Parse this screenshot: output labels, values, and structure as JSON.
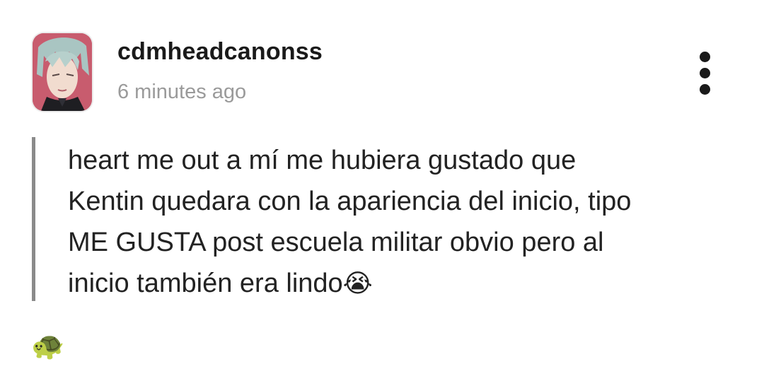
{
  "post": {
    "author": {
      "username": "cdmheadcanonss",
      "avatar_icon": "anime-character-avatar"
    },
    "timestamp": "6 minutes ago",
    "menu_icon": "more-vertical-icon",
    "text_lines": [
      "heart me out a mí me hubiera gustado que",
      "Kentin quedara con la apariencia del inicio, tipo",
      "ME GUSTA post escuela militar obvio pero al",
      "inicio también era lindo"
    ],
    "text_emoji": "😭",
    "footer_emoji": "🐢"
  },
  "colors": {
    "quote_bar": "#8a8a8a",
    "timestamp": "#9a9a9a",
    "text": "#222222",
    "avatar_bg": "#c85c6e"
  }
}
